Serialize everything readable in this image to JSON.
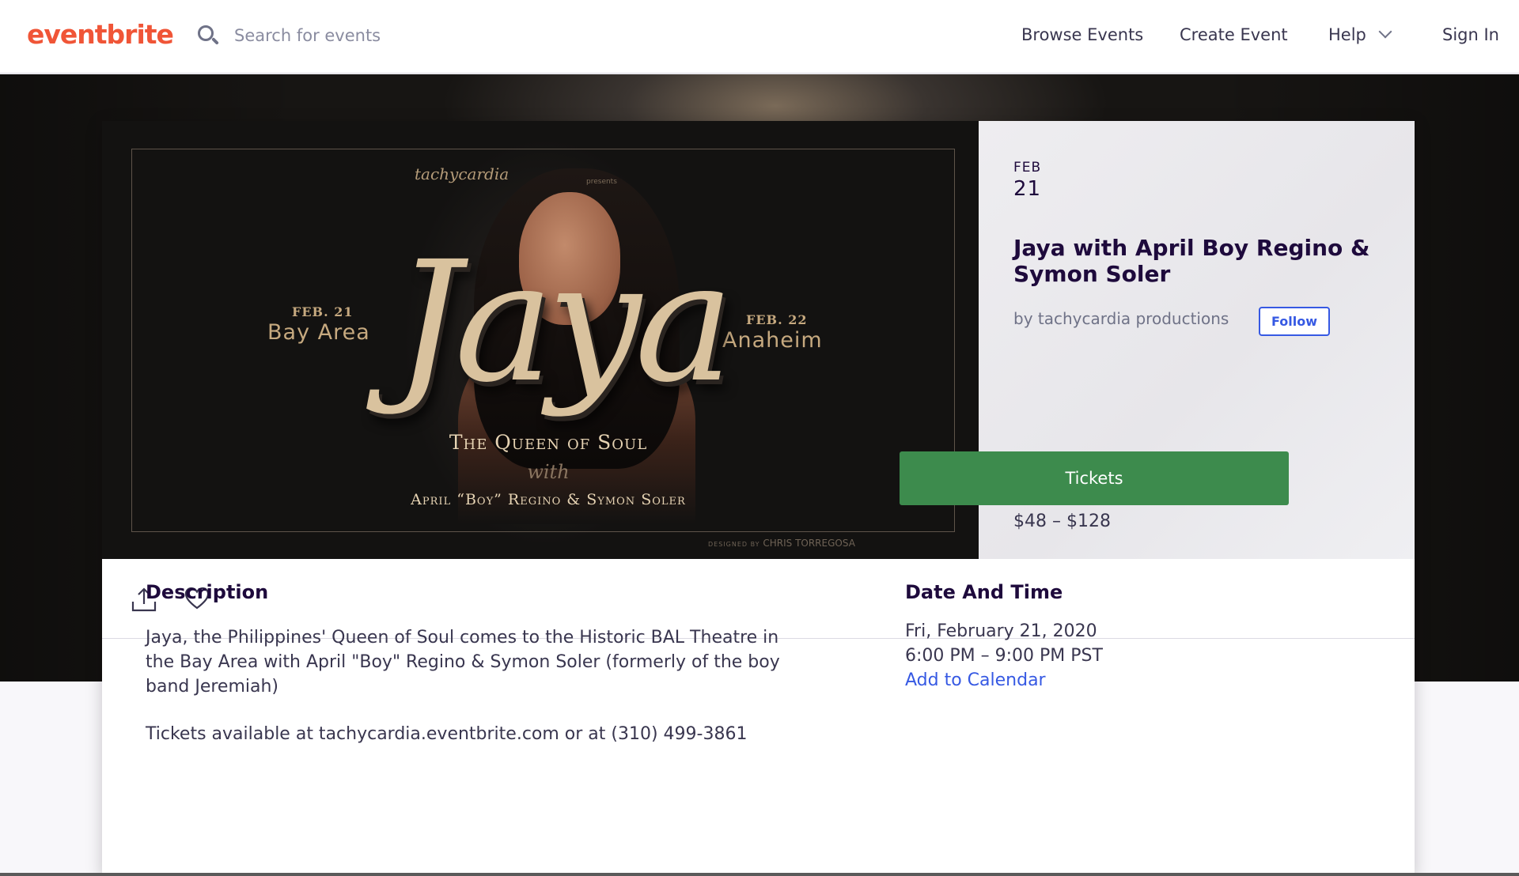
{
  "header": {
    "logo": "eventbrite",
    "search_placeholder": "Search for events",
    "nav": {
      "browse": "Browse Events",
      "create": "Create Event",
      "help": "Help",
      "sign_in": "Sign In"
    }
  },
  "banner": {
    "brand_mark": "tachycardia",
    "presents": "presents",
    "left_date": "FEB. 21",
    "left_city": "Bay Area",
    "right_date": "FEB. 22",
    "right_city": "Anaheim",
    "script_title": "Jaya",
    "subtitle": "The Queen of Soul",
    "with": "with",
    "guests": "April “Boy” Regino & Symon Soler",
    "credit_prefix": "DESIGNED BY",
    "credit_name": "CHRIS TORREGOSA"
  },
  "event": {
    "month": "FEB",
    "day": "21",
    "title": "Jaya with April Boy Regino & Symon Soler",
    "organizer": "by tachycardia productions",
    "follow_label": "Follow",
    "price": "$48 – $128",
    "tickets_label": "Tickets"
  },
  "icons": {
    "share": "share-icon",
    "like": "heart-icon",
    "search": "search-icon",
    "help_chevron": "chevron-down-icon"
  },
  "description": {
    "heading": "Description",
    "body": "Jaya, the Philippines' Queen of Soul comes to the Historic BAL Theatre in the Bay Area with April \"Boy\" Regino & Symon Soler (formerly of the boy band Jeremiah)",
    "tickets_note": "Tickets available at tachycardia.eventbrite.com or at (310) 499-3861"
  },
  "date_and_time": {
    "heading": "Date And Time",
    "date": "Fri, February 21, 2020",
    "time": "6:00 PM – 9:00 PM PST",
    "add_to_calendar": "Add to Calendar"
  },
  "colors": {
    "brand": "#f05537",
    "tickets_button": "#3d8b4d",
    "link": "#3659e3",
    "banner_gold": "#d9c29e"
  }
}
